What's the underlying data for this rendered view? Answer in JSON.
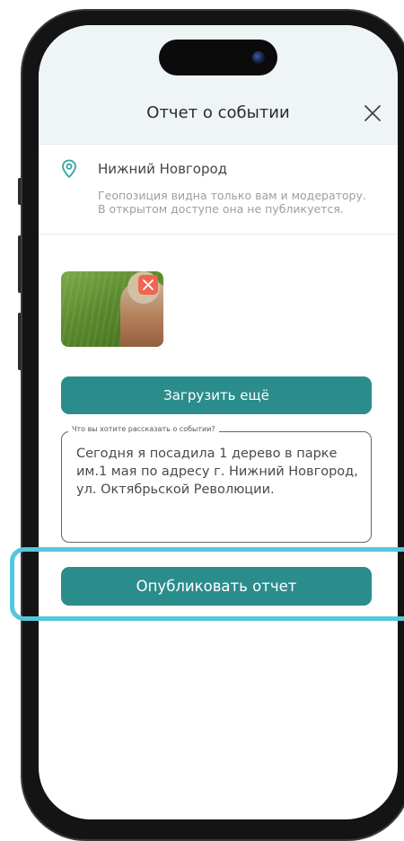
{
  "header": {
    "title": "Отчет о событии"
  },
  "location": {
    "city": "Нижний Новгород",
    "hint": "Геопозиция видна только вам и модератору. В открытом доступе она не публикуется."
  },
  "upload": {
    "label": "Загрузить ещё"
  },
  "story": {
    "label": "Что вы хотите рассказать о событии?",
    "value": "Сегодня я посадила 1 дерево в парке им.1 мая по адресу г. Нижний Новгород, ул. Октябрьской Революции."
  },
  "publish": {
    "label": "Опубликовать отчет"
  },
  "colors": {
    "accent": "#2b8c8c",
    "remove": "#f06652",
    "highlight": "#52c7de",
    "location_icon": "#2fa6a0"
  },
  "icons": {
    "close": "close-icon",
    "location": "location-pin-icon",
    "remove_photo": "close-icon"
  }
}
